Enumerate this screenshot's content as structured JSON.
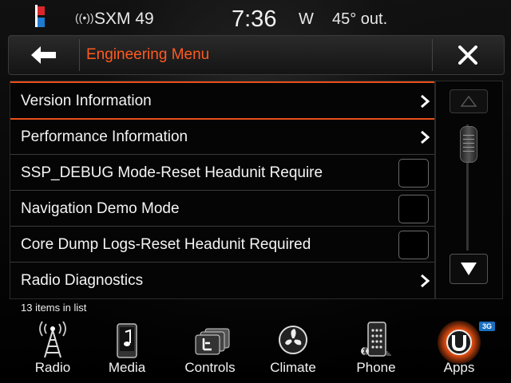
{
  "status": {
    "station": "SXM 49",
    "time": "7:36",
    "compass": "W",
    "outside_temp": "45° out."
  },
  "header": {
    "title": "Engineering Menu"
  },
  "list": {
    "items": [
      {
        "label": "Version Information",
        "type": "submenu",
        "selected": true
      },
      {
        "label": "Performance Information",
        "type": "submenu",
        "selected": false
      },
      {
        "label": "SSP_DEBUG Mode-Reset Headunit Require",
        "type": "checkbox",
        "checked": false
      },
      {
        "label": "Navigation Demo Mode",
        "type": "checkbox",
        "checked": false
      },
      {
        "label": "Core Dump Logs-Reset Headunit Required",
        "type": "checkbox",
        "checked": false
      },
      {
        "label": "Radio Diagnostics",
        "type": "submenu",
        "selected": false
      }
    ],
    "count_text": "13 items in list",
    "selection_color": "#e8501a"
  },
  "dock": {
    "items": [
      {
        "label": "Radio",
        "icon": "radio-tower-icon"
      },
      {
        "label": "Media",
        "icon": "media-music-icon"
      },
      {
        "label": "Controls",
        "icon": "controls-seat-icon"
      },
      {
        "label": "Climate",
        "icon": "climate-fan-icon"
      },
      {
        "label": "Phone",
        "icon": "phone-keypad-icon"
      },
      {
        "label": "Apps",
        "icon": "apps-uconnect-icon",
        "active": true
      }
    ],
    "apps_badge": "3G"
  },
  "colors": {
    "accent": "#ff5a1e",
    "background": "#000000"
  }
}
